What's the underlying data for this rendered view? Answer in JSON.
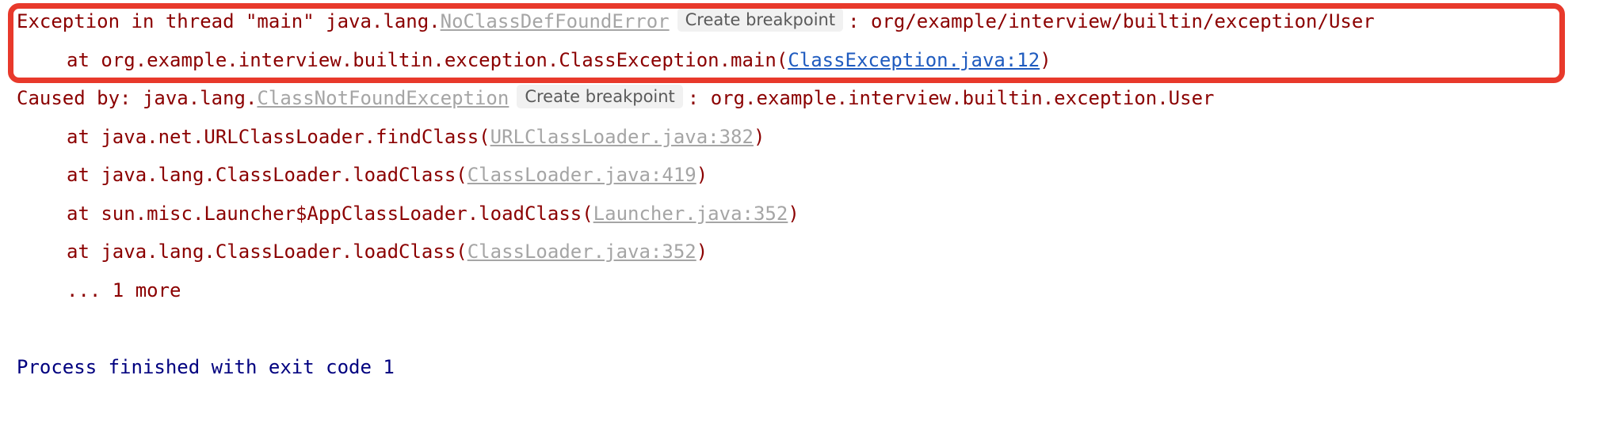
{
  "console": {
    "exception_line": {
      "prefix": "Exception in thread \"main\" java.lang.",
      "class_link": "NoClassDefFoundError",
      "breakpoint_button": "Create breakpoint",
      "suffix": ": org/example/interview/builtin/exception/User"
    },
    "main_frame": {
      "prefix": "at org.example.interview.builtin.exception.ClassException.main(",
      "source_link": "ClassException.java:12",
      "suffix": ")"
    },
    "caused_by_line": {
      "prefix": "Caused by: java.lang.",
      "class_link": "ClassNotFoundException",
      "breakpoint_button": "Create breakpoint",
      "suffix": ": org.example.interview.builtin.exception.User"
    },
    "frames": [
      {
        "prefix": "at java.net.URLClassLoader.findClass(",
        "source_link": "URLClassLoader.java:382",
        "suffix": ")"
      },
      {
        "prefix": "at java.lang.ClassLoader.loadClass(",
        "source_link": "ClassLoader.java:419",
        "suffix": ")"
      },
      {
        "prefix": "at sun.misc.Launcher$AppClassLoader.loadClass(",
        "source_link": "Launcher.java:352",
        "suffix": ")"
      },
      {
        "prefix": "at java.lang.ClassLoader.loadClass(",
        "source_link": "ClassLoader.java:352",
        "suffix": ")"
      }
    ],
    "more_line": "... 1 more",
    "process_line": "Process finished with exit code 1"
  },
  "colors": {
    "error_text": "#8b0000",
    "process_text": "#00007f",
    "link_blue": "#1f5bbf",
    "link_gray": "#a5a5a5",
    "highlight_border": "#e8392b"
  }
}
